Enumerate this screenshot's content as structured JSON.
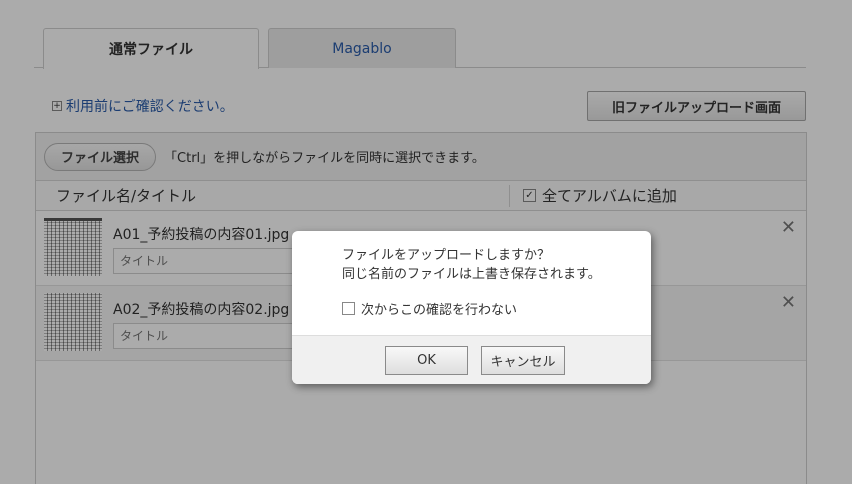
{
  "tabs": [
    {
      "label": "通常ファイル",
      "active": true
    },
    {
      "label": "Magablo",
      "active": false
    }
  ],
  "notice": {
    "prefix": "+",
    "text": "利用前にご確認ください。"
  },
  "old_upload_button": "旧ファイルアップロード画面",
  "toolbar": {
    "pick_button": "ファイル選択",
    "hint": "「Ctrl」を押しながらファイルを同時に選択できます。"
  },
  "table_header": {
    "name_title": "ファイル名/タイトル",
    "add_all": "全てアルバムに追加",
    "add_all_checked": true
  },
  "files": [
    {
      "name": "A01_予約投稿の内容01.jpg",
      "title_placeholder": "タイトル"
    },
    {
      "name": "A02_予約投稿の内容02.jpg",
      "title_placeholder": "タイトル"
    }
  ],
  "dialog": {
    "line1": "ファイルをアップロードしますか？",
    "line2": "同じ名前のファイルは上書き保存されます。",
    "dont_ask": "次からこの確認を行わない",
    "ok": "OK",
    "cancel": "キャンセル"
  },
  "colors": {
    "link": "#2a5caa",
    "overlay": "rgba(0,0,0,0.33)"
  }
}
